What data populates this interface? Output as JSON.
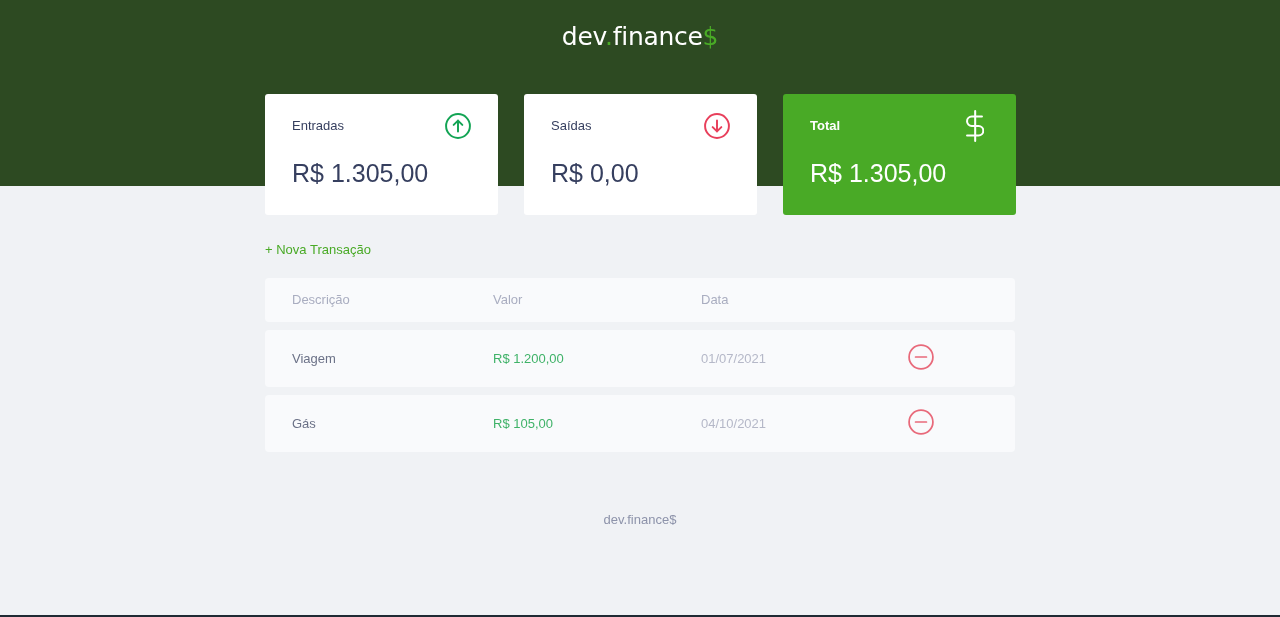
{
  "header": {
    "logo": {
      "prefix": "dev",
      "dot": ".",
      "name": "finance",
      "symbol": "$"
    }
  },
  "cards": [
    {
      "kind": "income",
      "label": "Entradas",
      "value": "R$ 1.305,00"
    },
    {
      "kind": "expense",
      "label": "Saídas",
      "value": "R$ 0,00"
    },
    {
      "kind": "total",
      "label": "Total",
      "value": "R$ 1.305,00"
    }
  ],
  "new_transaction_link": "+ Nova Transação",
  "table": {
    "columns": [
      "Descrição",
      "Valor",
      "Data"
    ],
    "rows": [
      {
        "description": "Viagem",
        "amount": "R$ 1.200,00",
        "kind": "income",
        "date": "01/07/2021"
      },
      {
        "description": "Gás",
        "amount": "R$ 105,00",
        "kind": "income",
        "date": "04/10/2021"
      }
    ]
  },
  "footer": "dev.finance$"
}
